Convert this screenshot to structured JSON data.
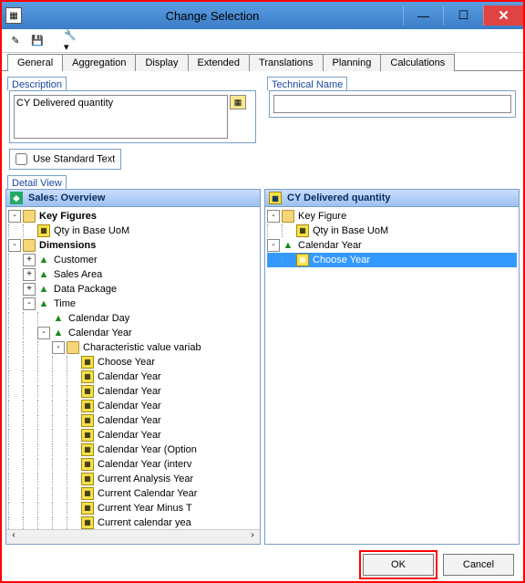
{
  "window": {
    "title": "Change Selection"
  },
  "tabs": [
    "General",
    "Aggregation",
    "Display",
    "Extended",
    "Translations",
    "Planning",
    "Calculations"
  ],
  "active_tab": 0,
  "desc": {
    "label": "Description",
    "value": "CY Delivered quantity"
  },
  "tech": {
    "label": "Technical Name",
    "value": ""
  },
  "std": {
    "label": "Use Standard Text",
    "checked": false
  },
  "detail_label": "Detail View",
  "left_panel": {
    "title": "Sales: Overview"
  },
  "right_panel": {
    "title": "CY Delivered quantity"
  },
  "left_tree": [
    {
      "d": 0,
      "tw": "-",
      "ico": "folder",
      "bold": true,
      "label": "Key Figures"
    },
    {
      "d": 1,
      "tw": "",
      "ico": "yellow",
      "label": "Qty in Base UoM"
    },
    {
      "d": 0,
      "tw": "-",
      "ico": "folder",
      "bold": true,
      "label": "Dimensions"
    },
    {
      "d": 1,
      "tw": "+",
      "ico": "green",
      "label": "Customer"
    },
    {
      "d": 1,
      "tw": "+",
      "ico": "green",
      "label": "Sales Area"
    },
    {
      "d": 1,
      "tw": "+",
      "ico": "green",
      "label": "Data Package"
    },
    {
      "d": 1,
      "tw": "-",
      "ico": "green",
      "label": "Time"
    },
    {
      "d": 2,
      "tw": "",
      "ico": "green",
      "label": "Calendar Day"
    },
    {
      "d": 2,
      "tw": "-",
      "ico": "green",
      "label": "Calendar Year"
    },
    {
      "d": 3,
      "tw": "-",
      "ico": "folder",
      "label": "Characteristic value variab"
    },
    {
      "d": 4,
      "tw": "",
      "ico": "yellow",
      "label": "Choose Year"
    },
    {
      "d": 4,
      "tw": "",
      "ico": "yellow",
      "label": "Calendar Year"
    },
    {
      "d": 4,
      "tw": "",
      "ico": "yellow",
      "label": "Calendar Year"
    },
    {
      "d": 4,
      "tw": "",
      "ico": "yellow",
      "label": "Calendar Year"
    },
    {
      "d": 4,
      "tw": "",
      "ico": "yellow",
      "label": "Calendar Year"
    },
    {
      "d": 4,
      "tw": "",
      "ico": "yellow",
      "label": "Calendar Year"
    },
    {
      "d": 4,
      "tw": "",
      "ico": "yellow",
      "label": "Calendar Year (Option"
    },
    {
      "d": 4,
      "tw": "",
      "ico": "yellow",
      "label": "Calendar Year (interv"
    },
    {
      "d": 4,
      "tw": "",
      "ico": "yellow",
      "label": "Current Analysis Year"
    },
    {
      "d": 4,
      "tw": "",
      "ico": "yellow",
      "label": "Current Calendar Year"
    },
    {
      "d": 4,
      "tw": "",
      "ico": "yellow",
      "label": "Current Year Minus T"
    },
    {
      "d": 4,
      "tw": "",
      "ico": "yellow",
      "label": "Current calendar yea"
    }
  ],
  "right_tree": [
    {
      "d": 0,
      "tw": "-",
      "ico": "folder",
      "label": "Key Figure"
    },
    {
      "d": 1,
      "tw": "",
      "ico": "yellow",
      "label": "Qty in Base UoM"
    },
    {
      "d": 0,
      "tw": "-",
      "ico": "green",
      "label": "Calendar Year"
    },
    {
      "d": 1,
      "tw": "",
      "ico": "yellow",
      "sel": true,
      "label": "Choose Year"
    }
  ],
  "footer": {
    "ok": "OK",
    "cancel": "Cancel"
  }
}
